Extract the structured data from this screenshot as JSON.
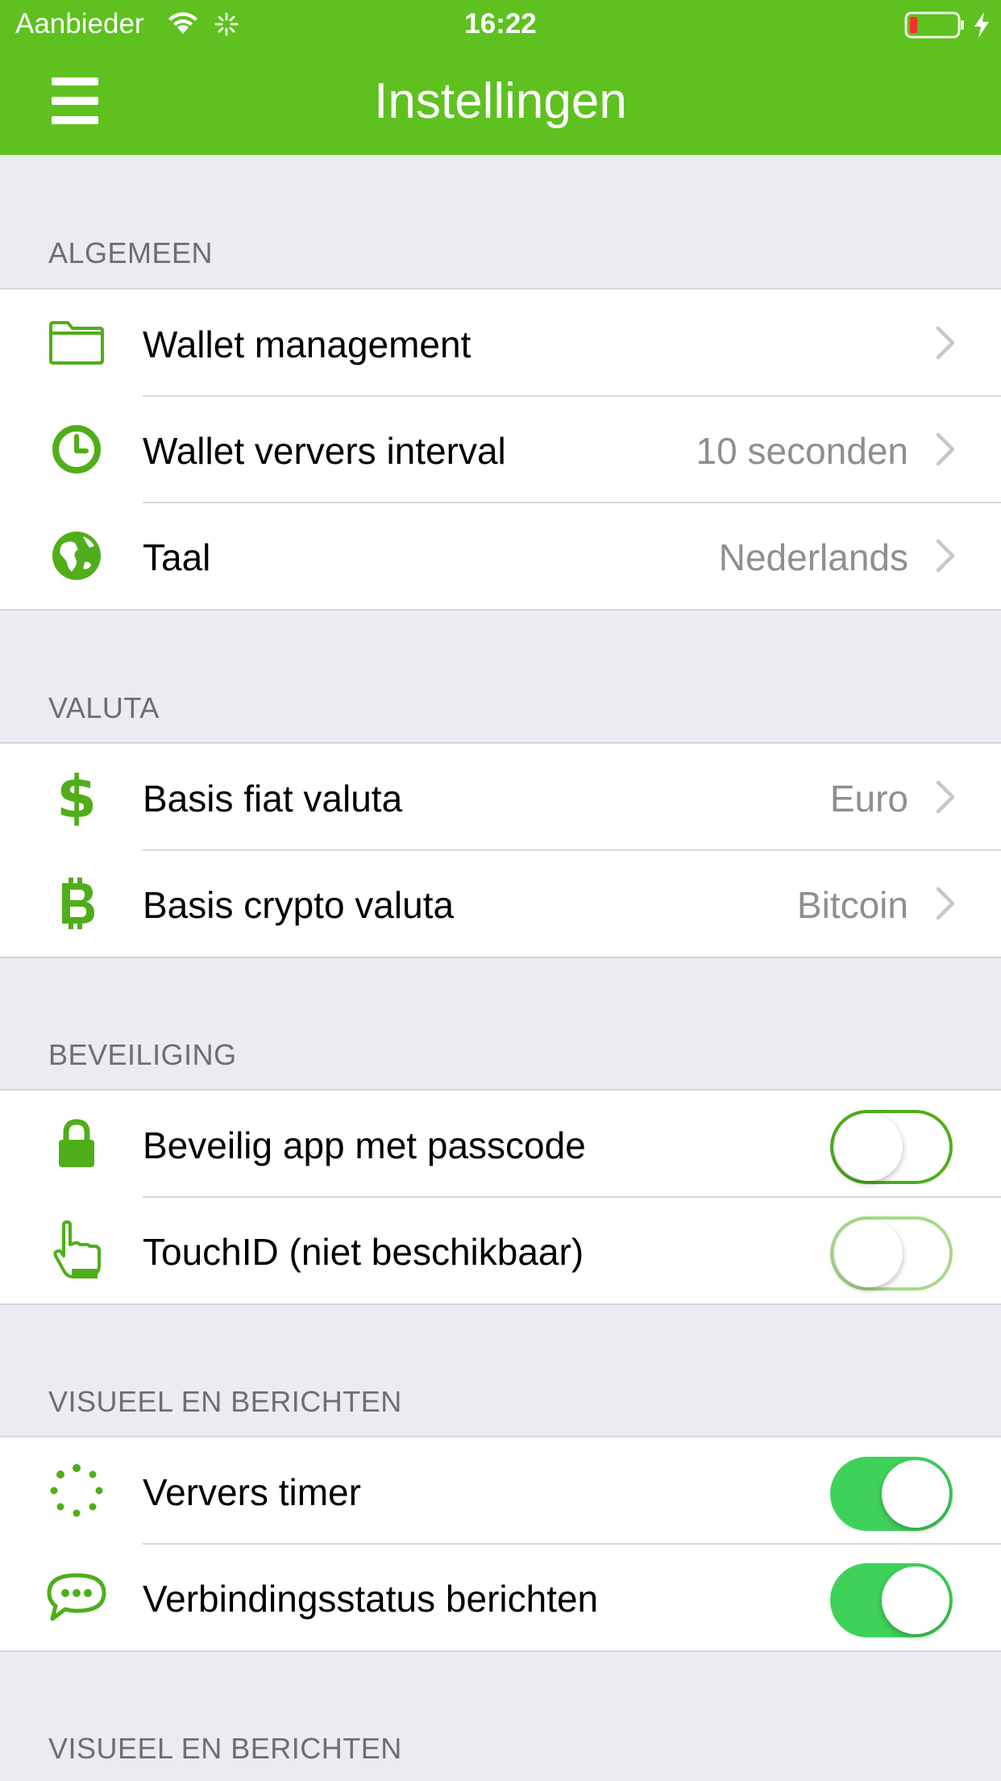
{
  "status_bar": {
    "carrier": "Aanbieder",
    "time": "16:22"
  },
  "nav": {
    "title": "Instellingen",
    "menu_icon": "hamburger-menu-icon"
  },
  "colors": {
    "brand_green": "#5ec11f",
    "toggle_on": "#3fd25a",
    "background": "#ebebf1"
  },
  "sections": {
    "general": {
      "header": "ALGEMEEN",
      "rows": [
        {
          "label": "Wallet management",
          "value": "",
          "icon": "folder-icon"
        },
        {
          "label": "Wallet ververs interval",
          "value": "10 seconden",
          "icon": "clock-icon"
        },
        {
          "label": "Taal",
          "value": "Nederlands",
          "icon": "globe-icon"
        }
      ]
    },
    "currency": {
      "header": "VALUTA",
      "rows": [
        {
          "label": "Basis fiat valuta",
          "value": "Euro",
          "icon": "dollar-icon"
        },
        {
          "label": "Basis crypto valuta",
          "value": "Bitcoin",
          "icon": "bitcoin-icon"
        }
      ]
    },
    "security": {
      "header": "BEVEILIGING",
      "rows": [
        {
          "label": "Beveilig app met passcode",
          "toggle_on": false,
          "icon": "lock-icon"
        },
        {
          "label": "TouchID (niet beschikbaar)",
          "toggle_on": false,
          "disabled": true,
          "icon": "pointing-hand-icon"
        }
      ]
    },
    "visual": {
      "header": "VISUEEL EN BERICHTEN",
      "rows": [
        {
          "label": "Ververs timer",
          "toggle_on": true,
          "icon": "dotted-spinner-icon"
        },
        {
          "label": "Verbindingsstatus berichten",
          "toggle_on": true,
          "icon": "speech-bubble-icon"
        }
      ]
    },
    "visual_2": {
      "header": "VISUEEL EN BERICHTEN"
    }
  }
}
